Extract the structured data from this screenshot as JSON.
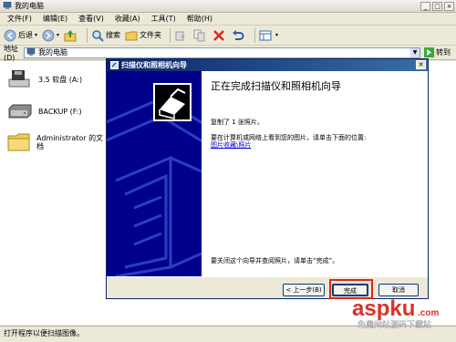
{
  "window": {
    "title": "我的电脑",
    "controls": [
      "_",
      "□",
      "×"
    ]
  },
  "menu": [
    "文件(F)",
    "编辑(E)",
    "查看(V)",
    "收藏(A)",
    "工具(T)",
    "帮助(H)"
  ],
  "toolbar": {
    "back": "后退",
    "search": "搜索",
    "folders": "文件夹"
  },
  "address": {
    "label": "地址(D)",
    "value": "我的电脑",
    "go": "转到"
  },
  "items": [
    {
      "label": "3.5 软盘 (A:)"
    },
    {
      "label": "BACKUP (F:)"
    },
    {
      "label_line1": "Administrator 的文",
      "label_line2": "档"
    }
  ],
  "status": "打开程序以便扫描图像。",
  "dialog": {
    "title": "扫描仪和照相机向导",
    "heading": "正在完成扫描仪和照相机向导",
    "copied": "复制了 1 张照片。",
    "location_text": "要在计算机或网络上看到您的图片，请单击下面的位置:",
    "location_link": "图片收藏\\照片",
    "close_text": "要关闭这个向导并查阅照片，请单击“完成”。",
    "back_button": "< 上一步(B)",
    "finish_button": "完成",
    "cancel_button": "取消"
  },
  "watermark": {
    "brand": "aspku",
    "brand_suffix": ".com",
    "tagline": "免费网站源码下载站"
  },
  "colors": {
    "accent": "#0a246a",
    "sidebar": "#00008b",
    "highlight": "#e0261c",
    "link": "#0000cc"
  }
}
